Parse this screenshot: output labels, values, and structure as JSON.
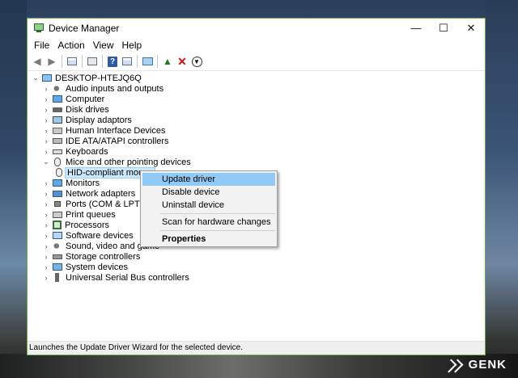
{
  "window": {
    "title": "Device Manager",
    "controls": {
      "minimize": "—",
      "maximize": "☐",
      "close": "✕"
    }
  },
  "menu": [
    "File",
    "Action",
    "View",
    "Help"
  ],
  "tree": {
    "root": "DESKTOP-HTEJQ6Q",
    "categories": [
      {
        "label": "Audio inputs and outputs",
        "icon": "speaker-icon"
      },
      {
        "label": "Computer",
        "icon": "computer-icon"
      },
      {
        "label": "Disk drives",
        "icon": "disk-icon"
      },
      {
        "label": "Display adaptors",
        "icon": "display-icon"
      },
      {
        "label": "Human Interface Devices",
        "icon": "hid-icon"
      },
      {
        "label": "IDE ATA/ATAPI controllers",
        "icon": "ide-icon"
      },
      {
        "label": "Keyboards",
        "icon": "keyboard-icon"
      },
      {
        "label": "Mice and other pointing devices",
        "icon": "mouse-icon",
        "expanded": true,
        "children": [
          {
            "label": "HID-compliant mouse",
            "icon": "mouse-icon",
            "selected": true
          }
        ]
      },
      {
        "label": "Monitors",
        "icon": "monitor-icon"
      },
      {
        "label": "Network adapters",
        "icon": "network-icon"
      },
      {
        "label": "Ports (COM & LPT)",
        "icon": "port-icon"
      },
      {
        "label": "Print queues",
        "icon": "printer-icon"
      },
      {
        "label": "Processors",
        "icon": "processor-icon"
      },
      {
        "label": "Software devices",
        "icon": "software-icon"
      },
      {
        "label": "Sound, video and game",
        "icon": "speaker-icon"
      },
      {
        "label": "Storage controllers",
        "icon": "storage-icon"
      },
      {
        "label": "System devices",
        "icon": "system-icon"
      },
      {
        "label": "Universal Serial Bus controllers",
        "icon": "usb-icon"
      }
    ]
  },
  "context_menu": {
    "items": [
      "Update driver",
      "Disable device",
      "Uninstall device",
      "Scan for hardware changes",
      "Properties"
    ],
    "highlighted": "Update driver",
    "bold": "Properties"
  },
  "status": "Launches the Update Driver Wizard for the selected device.",
  "watermark": "GENK",
  "colors": {
    "window_border": "#6ea84b",
    "menu_highlight": "#91c9f7",
    "selection": "#cce8ff"
  }
}
